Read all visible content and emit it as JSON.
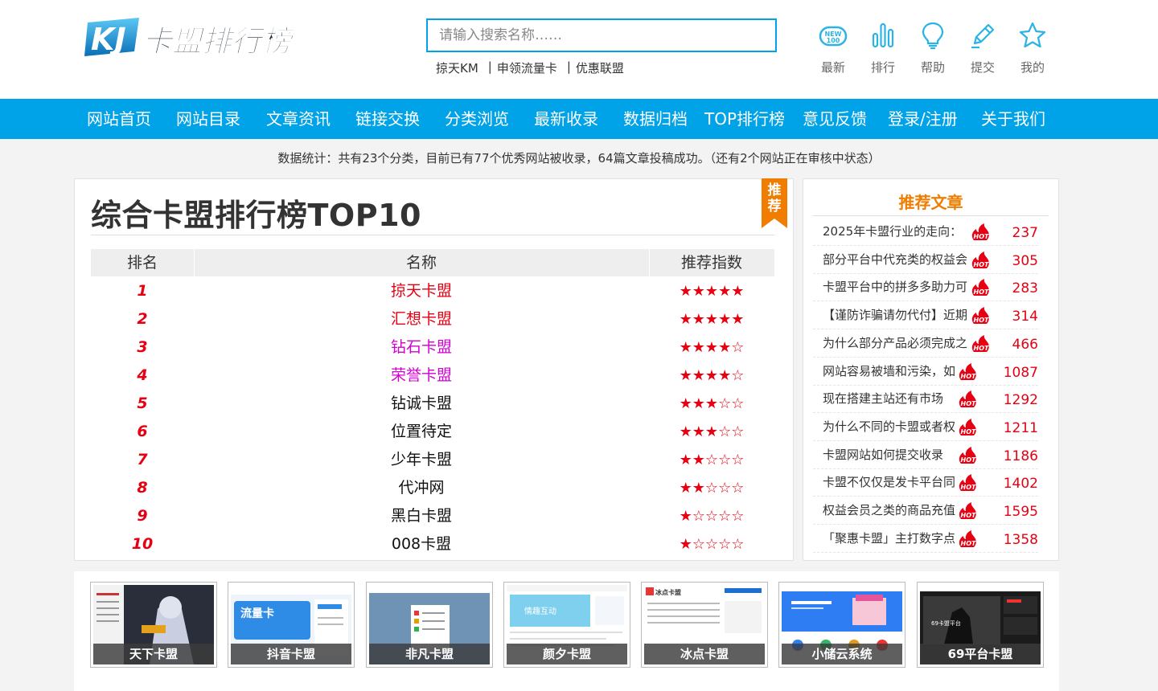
{
  "header": {
    "logo_text": "KJ卡盟排行榜",
    "search_placeholder": "请输入搜索名称……",
    "quick_links": [
      "掠天KM",
      "申领流量卡",
      "优惠联盟"
    ],
    "quick_sep": "|",
    "tools": [
      {
        "label": "最新",
        "icon": "new-icon"
      },
      {
        "label": "排行",
        "icon": "bar-chart-icon"
      },
      {
        "label": "帮助",
        "icon": "lightbulb-icon"
      },
      {
        "label": "提交",
        "icon": "pencil-icon"
      },
      {
        "label": "我的",
        "icon": "star-icon"
      }
    ]
  },
  "nav": {
    "items": [
      "网站首页",
      "网站目录",
      "文章资讯",
      "链接交换",
      "分类浏览",
      "最新收录",
      "数据归档",
      "TOP排行榜",
      "意见反馈",
      "登录/注册",
      "关于我们"
    ]
  },
  "stats": "数据统计：共有23个分类，目前已有77个优秀网站被收录，64篇文章投稿成功。（还有2个网站正在审核中状态）",
  "ranking": {
    "title": "综合卡盟排行榜TOP10",
    "ribbon": "推荐",
    "headers": [
      "排名",
      "名称",
      "推荐指数"
    ],
    "rows": [
      {
        "rank": "1",
        "name": "掠天卡盟",
        "color": "#e60012",
        "stars": "★★★★★"
      },
      {
        "rank": "2",
        "name": "汇想卡盟",
        "color": "#e60012",
        "stars": "★★★★★"
      },
      {
        "rank": "3",
        "name": "钻石卡盟",
        "color": "#d000d0",
        "stars": "★★★★☆"
      },
      {
        "rank": "4",
        "name": "荣誉卡盟",
        "color": "#d000d0",
        "stars": "★★★★☆"
      },
      {
        "rank": "5",
        "name": "钻诚卡盟",
        "color": "#111111",
        "stars": "★★★☆☆"
      },
      {
        "rank": "6",
        "name": "位置待定",
        "color": "#111111",
        "stars": "★★★☆☆"
      },
      {
        "rank": "7",
        "name": "少年卡盟",
        "color": "#111111",
        "stars": "★★☆☆☆"
      },
      {
        "rank": "8",
        "name": "代冲网",
        "color": "#111111",
        "stars": "★★☆☆☆"
      },
      {
        "rank": "9",
        "name": "黑白卡盟",
        "color": "#111111",
        "stars": "★☆☆☆☆"
      },
      {
        "rank": "10",
        "name": "008卡盟",
        "color": "#111111",
        "stars": "★☆☆☆☆"
      }
    ]
  },
  "articles": {
    "title": "推荐文章",
    "hot_label": "HOT",
    "items": [
      {
        "text": "2025年卡盟行业的走向：",
        "count": "237"
      },
      {
        "text": "部分平台中代充类的权益会",
        "count": "305"
      },
      {
        "text": "卡盟平台中的拼多多助力可",
        "count": "283"
      },
      {
        "text": "【谨防诈骗请勿代付】近期",
        "count": "314"
      },
      {
        "text": "为什么部分产品必须完成之",
        "count": "466"
      },
      {
        "text": "网站容易被墙和污染，如",
        "count": "1087"
      },
      {
        "text": "现在搭建主站还有市场",
        "count": "1292"
      },
      {
        "text": "为什么不同的卡盟或者权",
        "count": "1211"
      },
      {
        "text": "卡盟网站如何提交收录",
        "count": "1186"
      },
      {
        "text": "卡盟不仅仅是发卡平台同",
        "count": "1402"
      },
      {
        "text": "权益会员之类的商品充值",
        "count": "1595"
      },
      {
        "text": "「聚惠卡盟」主打数字点",
        "count": "1358"
      }
    ]
  },
  "thumbnails": [
    {
      "caption": "天下卡盟",
      "theme": "dark-anime"
    },
    {
      "caption": "抖音卡盟",
      "theme": "blue-card"
    },
    {
      "caption": "非凡卡盟",
      "theme": "blue-dashboard"
    },
    {
      "caption": "颜夕卡盟",
      "theme": "light-banner"
    },
    {
      "caption": "冰点卡盟",
      "theme": "white-list"
    },
    {
      "caption": "小储云系统",
      "theme": "blue-shop"
    },
    {
      "caption": "69平台卡盟",
      "theme": "dark-game"
    }
  ]
}
